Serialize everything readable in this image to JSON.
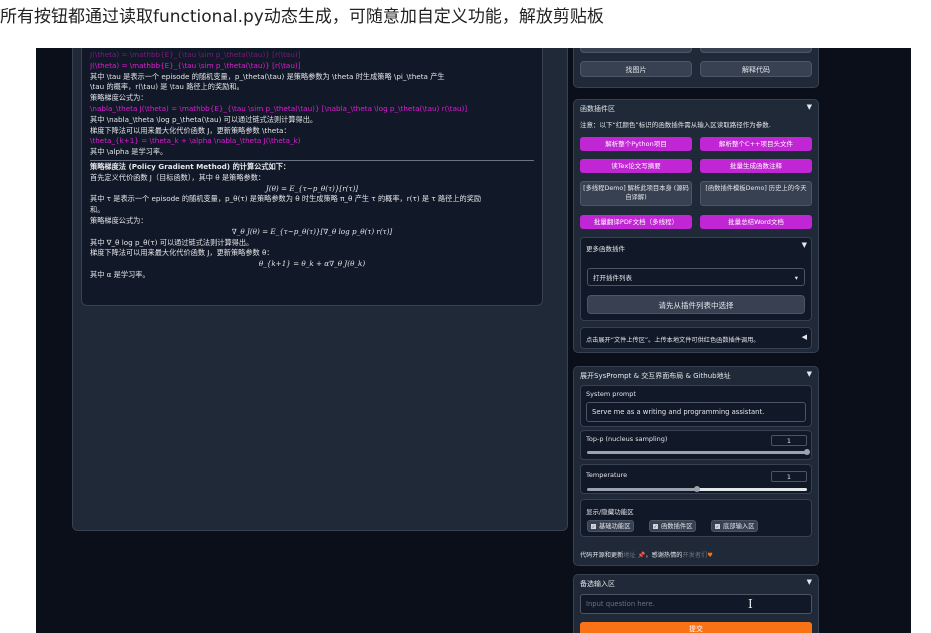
{
  "caption": "所有按钮都通过读取functional.py动态生成，可随意加自定义功能，解放剪贴板",
  "chat": {
    "lines_raw": [
      "J(\\theta) = \\mathbb{E}_{\\tau \\sim p_\\theta(\\tau)} [r(\\tau)]",
      "其中 \\tau 是表示一个 episode 的随机变量，p_\\theta(\\tau) 是策略参数为 \\theta 时生成策略 \\pi_\\theta 产生",
      "\\tau 的概率，r(\\tau) 是 \\tau 路径上的奖励和。",
      "策略梯度公式为：",
      "\\nabla_\\theta J(\\theta) = \\mathbb{E}_{\\tau \\sim p_\\theta(\\tau)} [\\nabla_\\theta \\log p_\\theta(\\tau) r(\\tau)]",
      "其中 \\nabla_\\theta \\log p_\\theta(\\tau) 可以通过链式法则计算得出。",
      "梯度下降法可以用来最大化代价函数 J，更新策略参数 \\theta：",
      "\\theta_{k+1} = \\theta_k + \\alpha \\nabla_\\theta J(\\theta_k)",
      "其中 \\alpha 是学习率。"
    ],
    "rendered_title": "策略梯度法 (Policy Gradient Method) 的计算公式如下：",
    "rendered_lines": [
      "首先定义代价函数 J（目标函数），其中 θ 是策略参数：",
      "J(θ) = E_{τ~p_θ(τ)}[r(τ)]",
      "其中 τ 是表示一个 episode 的随机变量，p_θ(τ) 是策略参数为 θ 时生成策略 π_θ 产生 τ 的概率，r(τ) 是 τ 路径上的奖励",
      "和。",
      "策略梯度公式为：",
      "∇_θ J(θ) = E_{τ~p_θ(τ)}[∇_θ log p_θ(τ) r(τ)]",
      "其中 ∇_θ log p_θ(τ) 可以通过链式法则计算得出。",
      "梯度下降法可以用来最大化代价函数 J，更新策略参数 θ：",
      "θ_{k+1} = θ_k + α∇_θ J(θ_k)",
      "其中 α 是学习率。"
    ]
  },
  "top_buttons": [
    "找图片",
    "解释代码"
  ],
  "func_plugins": {
    "title": "函数插件区",
    "note": "注意：以下“红颜色”标识的函数插件需从输入区读取路径作为参数.",
    "buttons": [
      "解析整个Python项目",
      "解析整个C++项目头文件",
      "读Tex论文写摘要",
      "批量生成函数注释",
      "[多线程Demo] 解析此项目本身 (源码自译解)",
      "[函数插件模板Demo] 历史上的今天",
      "批量翻译PDF文档（多线程）",
      "批量总结Word文档"
    ],
    "more_title": "更多函数插件",
    "dropdown_value": "打开插件列表",
    "select_button": "请先从插件列表中选择",
    "upload_hint": "点击展开“文件上传区”。上传本地文件可供红色函数插件调用。"
  },
  "sysprompt": {
    "title": "展开SysPrompt & 交互界面布局 & Github地址",
    "prompt_label": "System prompt",
    "prompt_value": "Serve me as a writing and programming assistant.",
    "top_p_label": "Top-p (nucleus sampling)",
    "top_p_value": "1",
    "top_p_fraction": 1.0,
    "temp_label": "Temperature",
    "temp_value": "1",
    "temp_fraction": 0.5,
    "toggle_label": "显示/隐藏功能区",
    "checkboxes": [
      "基础功能区",
      "函数插件区",
      "底部输入区"
    ],
    "footer": "代码开源和更新",
    "footer_link1": "地址",
    "footer_mid": "，感谢热情的",
    "footer_link2": "开发者们"
  },
  "backup_input": {
    "title": "备选输入区",
    "placeholder": "Input question here.",
    "submit": "提交"
  },
  "colors": {
    "magenta": "#c026d3",
    "orange": "#f97316",
    "bg": "#0b0f19"
  }
}
